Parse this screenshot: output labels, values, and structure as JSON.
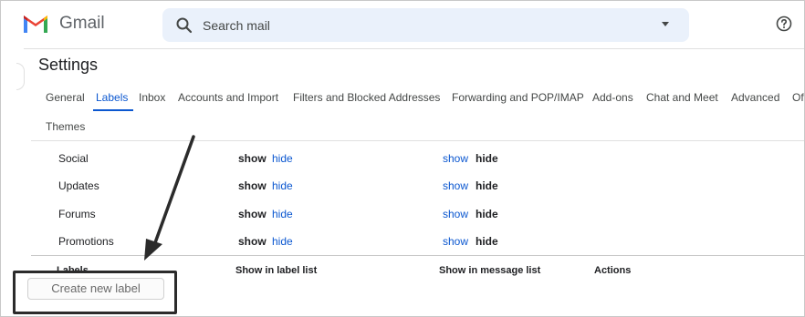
{
  "app": {
    "name": "Gmail"
  },
  "search": {
    "placeholder": "Search mail"
  },
  "page": {
    "title": "Settings"
  },
  "tabs": [
    {
      "label": "General",
      "active": false
    },
    {
      "label": "Labels",
      "active": true
    },
    {
      "label": "Inbox",
      "active": false
    },
    {
      "label": "Accounts and Import",
      "active": false
    },
    {
      "label": "Filters and Blocked Addresses",
      "active": false
    },
    {
      "label": "Forwarding and POP/IMAP",
      "active": false
    },
    {
      "label": "Add-ons",
      "active": false
    },
    {
      "label": "Chat and Meet",
      "active": false
    },
    {
      "label": "Advanced",
      "active": false
    },
    {
      "label": "Of",
      "active": false
    },
    {
      "label": "Themes",
      "active": false
    }
  ],
  "categories": [
    {
      "name": "Social",
      "show": "show",
      "hide": "hide",
      "msg_show": "show",
      "msg_hide": "hide"
    },
    {
      "name": "Updates",
      "show": "show",
      "hide": "hide",
      "msg_show": "show",
      "msg_hide": "hide"
    },
    {
      "name": "Forums",
      "show": "show",
      "hide": "hide",
      "msg_show": "show",
      "msg_hide": "hide"
    },
    {
      "name": "Promotions",
      "show": "show",
      "hide": "hide",
      "msg_show": "show",
      "msg_hide": "hide"
    }
  ],
  "columns": {
    "labels": "Labels",
    "label_list": "Show in label list",
    "message_list": "Show in message list",
    "actions": "Actions"
  },
  "create_label_button": "Create new label",
  "colors": {
    "accent": "#0b57d0",
    "search_bg": "#eaf1fb",
    "annotation": "#2b2b2b"
  },
  "icons": {
    "logo": "gmail-logo",
    "search": "search-icon",
    "help": "help-icon",
    "dropdown": "caret-down-icon"
  }
}
